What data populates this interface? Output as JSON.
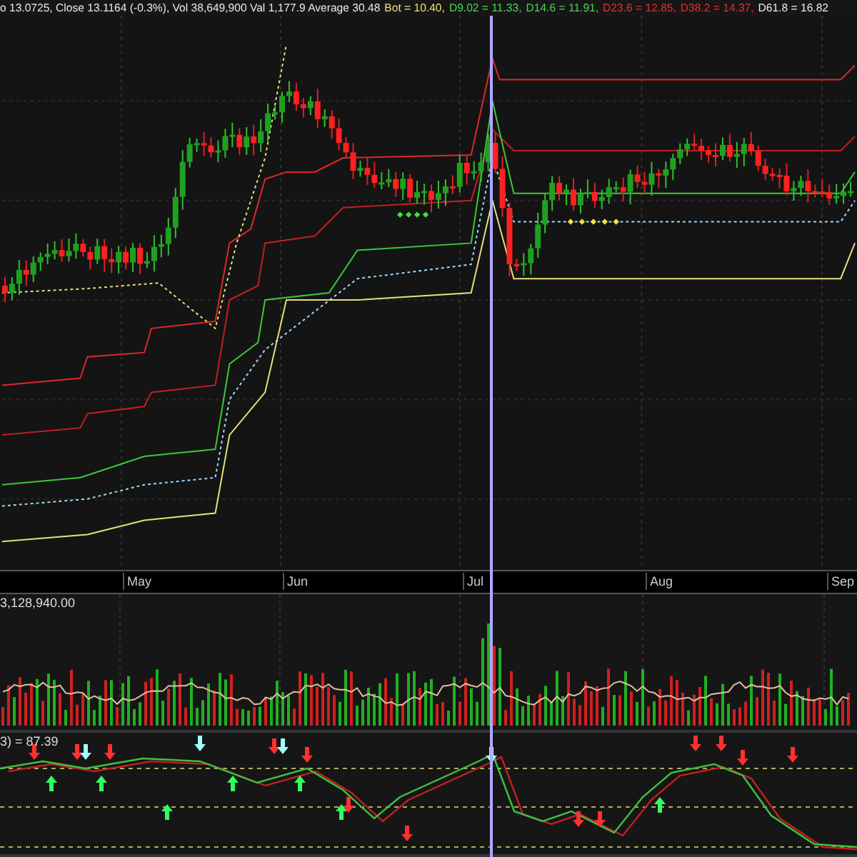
{
  "header": {
    "segments": [
      {
        "text": "o 13.0725, Close 13.1164 (-0.3%), Vol 38,649,900 Val 1,177.9 Average 30.48",
        "color": "#e8e8e8"
      },
      {
        "text": "Bot = 10.40,",
        "color": "#e6e07a"
      },
      {
        "text": "D9.02 = 11.33,",
        "color": "#4fd04f"
      },
      {
        "text": "D14.6 = 11.91,",
        "color": "#4fd04f"
      },
      {
        "text": "D23.6 = 12.85,",
        "color": "#e03030"
      },
      {
        "text": "D38.2 = 14.37,",
        "color": "#e03030"
      },
      {
        "text": "D61.8 = 16.82",
        "color": "#e8e8e8"
      }
    ]
  },
  "x_axis": {
    "labels": [
      "May",
      "Jun",
      "Jul",
      "Aug",
      "Sep"
    ]
  },
  "volume_panel": {
    "label": "3,128,940.00"
  },
  "indicator_panel": {
    "label": "3) = 87.39"
  }
}
